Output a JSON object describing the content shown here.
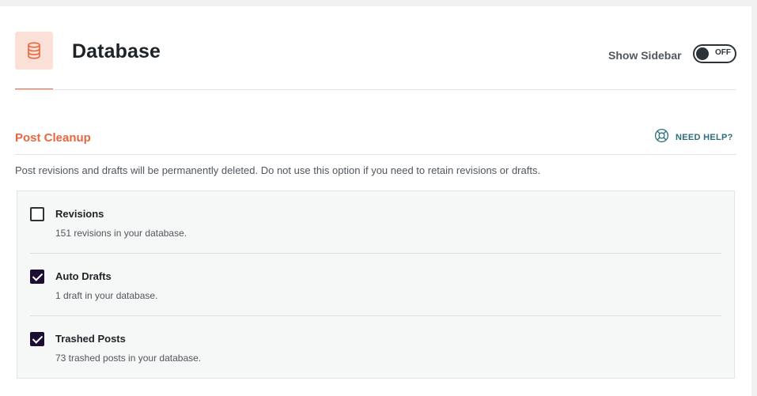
{
  "header": {
    "title": "Database",
    "icon": "database-icon",
    "show_sidebar_label": "Show Sidebar",
    "sidebar_toggle": {
      "state_label": "OFF",
      "enabled": false
    }
  },
  "section": {
    "title": "Post Cleanup",
    "help_label": "NEED HELP?",
    "help_icon": "lifebuoy-icon",
    "description": "Post revisions and drafts will be permanently deleted. Do not use this option if you need to retain revisions or drafts."
  },
  "options": [
    {
      "label": "Revisions",
      "description": "151 revisions in your database.",
      "checked": false
    },
    {
      "label": "Auto Drafts",
      "description": "1 draft in your database.",
      "checked": true
    },
    {
      "label": "Trashed Posts",
      "description": "73 trashed posts in your database.",
      "checked": true
    }
  ],
  "colors": {
    "accent": "#e9663f",
    "icon_bg": "#fbe0d7",
    "help": "#2a6f7b",
    "checkbox_checked": "#1a0f33"
  }
}
